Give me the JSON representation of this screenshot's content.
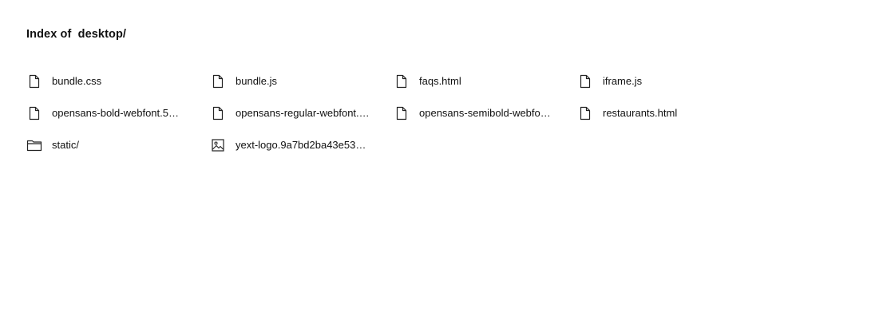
{
  "page": {
    "title": "Index of  desktop/"
  },
  "entries": [
    {
      "name": "bundle.css",
      "icon": "file-icon"
    },
    {
      "name": "bundle.js",
      "icon": "file-icon"
    },
    {
      "name": "faqs.html",
      "icon": "file-icon"
    },
    {
      "name": "iframe.js",
      "icon": "file-icon"
    },
    {
      "name": "opensans-bold-webfont.5…",
      "icon": "file-icon"
    },
    {
      "name": "opensans-regular-webfont.…",
      "icon": "file-icon"
    },
    {
      "name": "opensans-semibold-webfo…",
      "icon": "file-icon"
    },
    {
      "name": "restaurants.html",
      "icon": "file-icon"
    },
    {
      "name": "static/",
      "icon": "folder-icon"
    },
    {
      "name": "yext-logo.9a7bd2ba43e53…",
      "icon": "image-icon"
    }
  ]
}
